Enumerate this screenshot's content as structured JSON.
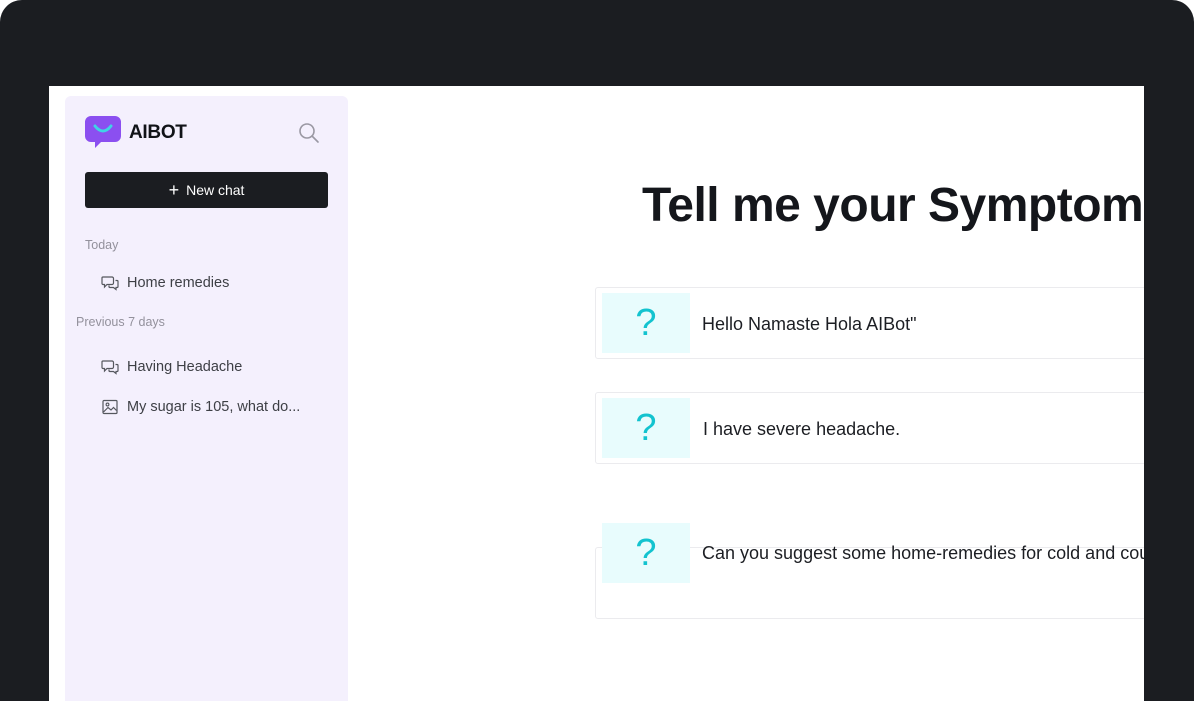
{
  "app": {
    "name": "AIBOT",
    "brand_color": "#8b4ff0",
    "accent_color": "#12c3cf"
  },
  "sidebar": {
    "search_icon": "search-icon",
    "new_chat_label": "New chat",
    "sections": [
      {
        "label": "Today",
        "items": [
          {
            "label": "Home remedies",
            "icon": "chat-bubbles-icon"
          }
        ]
      },
      {
        "label": "Previous 7 days",
        "items": [
          {
            "label": "Having Headache",
            "icon": "chat-bubbles-icon"
          },
          {
            "label": "My sugar is 105, what do...",
            "icon": "image-icon"
          }
        ]
      }
    ]
  },
  "main": {
    "title": "Tell me your Symptoms",
    "prompts": [
      {
        "icon": "question-mark-icon",
        "text": "Hello Namaste Hola AIBot\""
      },
      {
        "icon": "question-mark-icon",
        "text": "I have severe headache."
      },
      {
        "icon": "question-mark-icon",
        "text": "Can you suggest some home-remedies for cold and cough?"
      }
    ]
  }
}
